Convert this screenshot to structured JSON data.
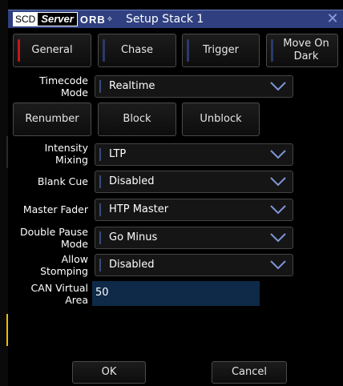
{
  "window": {
    "logo_scd": "SCD",
    "logo_server": "Server",
    "logo_orb": "ORB",
    "title": "Setup Stack 1"
  },
  "tabs": [
    {
      "label": "General",
      "accent": "#c01818"
    },
    {
      "label": "Chase",
      "accent": "#2a3a6a"
    },
    {
      "label": "Trigger",
      "accent": "#2a3a6a"
    },
    {
      "label": "Move On Dark",
      "accent": "#2a3a6a"
    }
  ],
  "timecode_mode": {
    "label": "Timecode\nMode",
    "value": "Realtime"
  },
  "actions": {
    "renumber": "Renumber",
    "block": "Block",
    "unblock": "Unblock"
  },
  "intensity_mixing": {
    "label": "Intensity\nMixing",
    "value": "LTP"
  },
  "blank_cue": {
    "label": "Blank Cue",
    "value": "Disabled"
  },
  "master_fader": {
    "label": "Master Fader",
    "value": "HTP Master"
  },
  "double_pause_mode": {
    "label": "Double Pause\nMode",
    "value": "Go Minus"
  },
  "allow_stomping": {
    "label": "Allow\nStomping",
    "value": "Disabled"
  },
  "can_virtual_area": {
    "label": "CAN Virtual\nArea",
    "value": "50"
  },
  "footer": {
    "ok": "OK",
    "cancel": "Cancel"
  },
  "colors": {
    "titlebar": "#2f3f7f",
    "general_accent": "#c01818",
    "field_bg": "#0e2a48"
  }
}
